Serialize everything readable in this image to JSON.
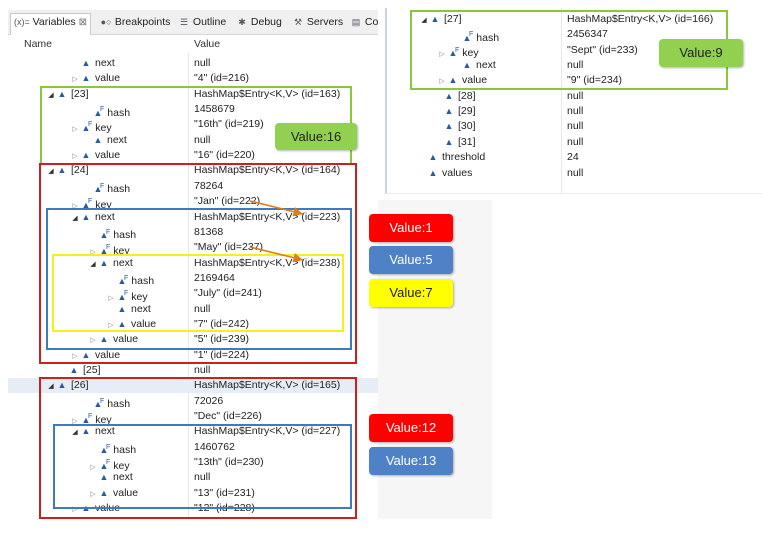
{
  "tabs": [
    {
      "icon": "(x)=",
      "label": "Variables",
      "close": "⊠"
    },
    {
      "icon": "●○",
      "label": "Breakpoints"
    },
    {
      "icon": "☰",
      "label": "Outline"
    },
    {
      "icon": "✱",
      "label": "Debug"
    },
    {
      "icon": "⚒",
      "label": "Servers"
    },
    {
      "icon": "▤",
      "label": "Co"
    }
  ],
  "headers": {
    "name": "Name",
    "value": "Value"
  },
  "left_rows": [
    {
      "name": "next",
      "value": "null"
    },
    {
      "name": "value",
      "value": "\"4\" (id=216)"
    },
    {
      "name": "[23]",
      "value": "HashMap$Entry<K,V>  (id=163)"
    },
    {
      "name": "hash",
      "value": "1458679"
    },
    {
      "name": "key",
      "value": "\"16th\" (id=219)"
    },
    {
      "name": "next",
      "value": "null"
    },
    {
      "name": "value",
      "value": "\"16\" (id=220)"
    },
    {
      "name": "[24]",
      "value": "HashMap$Entry<K,V>  (id=164)"
    },
    {
      "name": "hash",
      "value": "78264"
    },
    {
      "name": "key",
      "value": "\"Jan\" (id=222)"
    },
    {
      "name": "next",
      "value": "HashMap$Entry<K,V>  (id=223)"
    },
    {
      "name": "hash",
      "value": "81368"
    },
    {
      "name": "key",
      "value": "\"May\" (id=237)"
    },
    {
      "name": "next",
      "value": "HashMap$Entry<K,V>  (id=238)"
    },
    {
      "name": "hash",
      "value": "2169464"
    },
    {
      "name": "key",
      "value": "\"July\" (id=241)"
    },
    {
      "name": "next",
      "value": "null"
    },
    {
      "name": "value",
      "value": "\"7\" (id=242)"
    },
    {
      "name": "value",
      "value": "\"5\" (id=239)"
    },
    {
      "name": "value",
      "value": "\"1\" (id=224)"
    },
    {
      "name": "[25]",
      "value": "null"
    },
    {
      "name": "[26]",
      "value": "HashMap$Entry<K,V>  (id=165)"
    },
    {
      "name": "hash",
      "value": "72026"
    },
    {
      "name": "key",
      "value": "\"Dec\" (id=226)"
    },
    {
      "name": "next",
      "value": "HashMap$Entry<K,V>  (id=227)"
    },
    {
      "name": "hash",
      "value": "1460762"
    },
    {
      "name": "key",
      "value": "\"13th\" (id=230)"
    },
    {
      "name": "next",
      "value": "null"
    },
    {
      "name": "value",
      "value": "\"13\" (id=231)"
    },
    {
      "name": "value",
      "value": "\"12\" (id=228)"
    }
  ],
  "right_rows": [
    {
      "name": "[27]",
      "value": "HashMap$Entry<K,V>  (id=166)"
    },
    {
      "name": "hash",
      "value": "2456347"
    },
    {
      "name": "key",
      "value": "\"Sept\" (id=233)"
    },
    {
      "name": "next",
      "value": "null"
    },
    {
      "name": "value",
      "value": "\"9\" (id=234)"
    },
    {
      "name": "[28]",
      "value": "null"
    },
    {
      "name": "[29]",
      "value": "null"
    },
    {
      "name": "[30]",
      "value": "null"
    },
    {
      "name": "[31]",
      "value": "null"
    },
    {
      "name": "threshold",
      "value": "24"
    },
    {
      "name": "values",
      "value": "null"
    }
  ],
  "annotations": {
    "value16": "Value:16",
    "value9": "Value:9",
    "value1": "Value:1",
    "value5": "Value:5",
    "value7": "Value:7",
    "value12": "Value:12",
    "value13": "Value:13"
  },
  "colors": {
    "red": "#cc1f1f",
    "green": "#8cc63f",
    "blue": "#3e7ac0",
    "yellow": "#f5f01a",
    "arrow": "#e07b1a"
  }
}
